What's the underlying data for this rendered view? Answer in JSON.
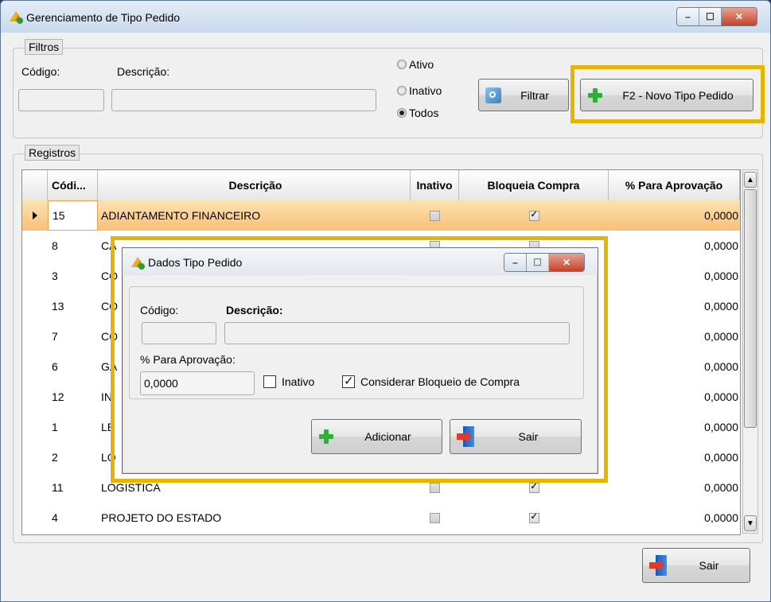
{
  "window": {
    "title": "Gerenciamento de Tipo Pedido"
  },
  "filters": {
    "group_title": "Filtros",
    "codigo_label": "Código:",
    "descricao_label": "Descrição:",
    "codigo_value": "",
    "descricao_value": "",
    "radios": [
      {
        "label": "Ativo",
        "checked": false
      },
      {
        "label": "Inativo",
        "checked": false
      },
      {
        "label": "Todos",
        "checked": true
      }
    ],
    "filter_button": "Filtrar",
    "new_button": "F2 - Novo Tipo Pedido"
  },
  "records": {
    "group_title": "Registros",
    "columns": [
      "Códi...",
      "Descrição",
      "Inativo",
      "Bloqueia Compra",
      "% Para Aprovação"
    ],
    "rows": [
      {
        "codigo": "15",
        "descricao": "ADIANTAMENTO FINANCEIRO",
        "inativo": false,
        "bloqueia": true,
        "aprovacao": "0,0000",
        "selected": true
      },
      {
        "codigo": "8",
        "descricao": "CA",
        "inativo": false,
        "bloqueia": false,
        "aprovacao": "0,0000"
      },
      {
        "codigo": "3",
        "descricao": "CO",
        "inativo": false,
        "bloqueia": false,
        "aprovacao": "0,0000"
      },
      {
        "codigo": "13",
        "descricao": "CO",
        "inativo": false,
        "bloqueia": false,
        "aprovacao": "0,0000"
      },
      {
        "codigo": "7",
        "descricao": "CO",
        "inativo": false,
        "bloqueia": false,
        "aprovacao": "0,0000"
      },
      {
        "codigo": "6",
        "descricao": "GA",
        "inativo": false,
        "bloqueia": false,
        "aprovacao": "0,0000"
      },
      {
        "codigo": "12",
        "descricao": "IN",
        "inativo": false,
        "bloqueia": false,
        "aprovacao": "0,0000"
      },
      {
        "codigo": "1",
        "descricao": "LE",
        "inativo": false,
        "bloqueia": false,
        "aprovacao": "0,0000"
      },
      {
        "codigo": "2",
        "descricao": "LO",
        "inativo": false,
        "bloqueia": false,
        "aprovacao": "0,0000"
      },
      {
        "codigo": "11",
        "descricao": "LOGISTICA",
        "inativo": false,
        "bloqueia": true,
        "aprovacao": "0,0000"
      },
      {
        "codigo": "4",
        "descricao": "PROJETO DO ESTADO",
        "inativo": false,
        "bloqueia": true,
        "aprovacao": "0,0000"
      }
    ]
  },
  "footer": {
    "exit_button": "Sair"
  },
  "dialog": {
    "title": "Dados Tipo Pedido",
    "codigo_label": "Código:",
    "descricao_label": "Descrição:",
    "codigo_value": "",
    "descricao_value": "",
    "aprovacao_label": "% Para Aprovação:",
    "aprovacao_value": "0,0000",
    "inativo_label": "Inativo",
    "inativo_checked": false,
    "bloqueio_label": "Considerar Bloqueio de Compra",
    "bloqueio_checked": true,
    "add_button": "Adicionar",
    "exit_button": "Sair"
  },
  "colors": {
    "highlight": "#e3b700",
    "selected_row": "#f8c077"
  }
}
